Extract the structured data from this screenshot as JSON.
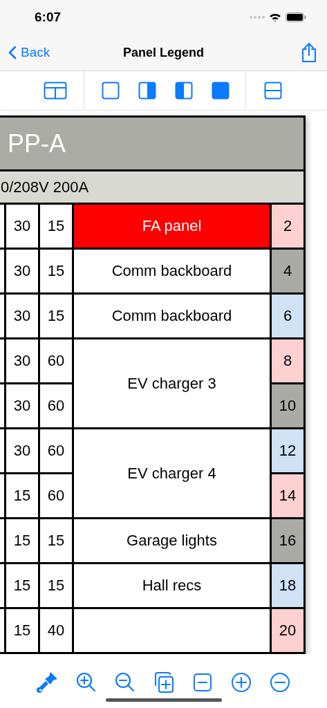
{
  "status_bar": {
    "time": "6:07"
  },
  "nav": {
    "back": "Back",
    "title": "Panel Legend"
  },
  "panel": {
    "name": "PP-A",
    "rating": "0/208V 200A"
  },
  "circuits": [
    {
      "column_1": "30",
      "column_2": "15",
      "number": "2",
      "color": "#ffd0d0",
      "load": {
        "text": "FA panel",
        "color": "#ff0000"
      }
    },
    {
      "column_1": "30",
      "column_2": "15",
      "number": "4",
      "color": "#aaaba4",
      "load": {
        "text": "Comm backboard",
        "color": "#ffffff"
      }
    },
    {
      "column_1": "30",
      "column_2": "15",
      "number": "6",
      "color": "#d0e2f6",
      "load": {
        "text": "Comm backboard",
        "color": "#ffffff"
      }
    },
    {
      "column_1": "30",
      "column_2": "60",
      "number": "8",
      "color": "#ffd0d0",
      "load": {
        "text": "EV charger 3",
        "color": "#ffffff"
      }
    },
    {
      "column_1": "30",
      "column_2": "60",
      "number": "10",
      "color": "#aaaba4"
    },
    {
      "column_1": "30",
      "column_2": "60",
      "number": "12",
      "color": "#d0e2f6",
      "load": {
        "text": "EV charger 4",
        "color": "#ffffff"
      }
    },
    {
      "column_1": "15",
      "column_2": "60",
      "number": "14",
      "color": "#ffd0d0"
    },
    {
      "column_1": "15",
      "column_2": "15",
      "number": "16",
      "color": "#aaaba4",
      "load": {
        "text": "Garage lights",
        "color": "#ffffff"
      }
    },
    {
      "column_1": "15",
      "column_2": "15",
      "number": "18",
      "color": "#d0e2f6",
      "load": {
        "text": "Hall recs",
        "color": "#ffffff"
      }
    },
    {
      "column_1": "15",
      "column_2": "40",
      "number": "20",
      "color": "#ffd0d0",
      "load": {
        "color": "#ffffff"
      }
    }
  ]
}
